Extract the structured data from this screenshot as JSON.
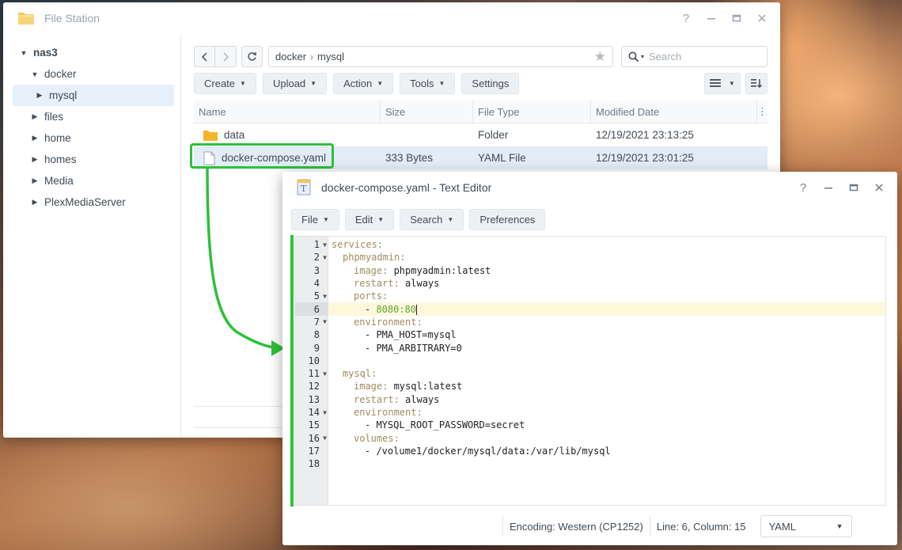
{
  "file_station": {
    "title": "File Station",
    "window_controls": {
      "help": "?"
    },
    "tree": [
      {
        "label": "nas3",
        "level": 0,
        "expanded": true
      },
      {
        "label": "docker",
        "level": 1,
        "expanded": true
      },
      {
        "label": "mysql",
        "level": 2,
        "expanded": false,
        "selected": true
      },
      {
        "label": "files",
        "level": 1,
        "expanded": false
      },
      {
        "label": "home",
        "level": 1,
        "expanded": false
      },
      {
        "label": "homes",
        "level": 1,
        "expanded": false
      },
      {
        "label": "Media",
        "level": 1,
        "expanded": false
      },
      {
        "label": "PlexMediaServer",
        "level": 1,
        "expanded": false
      }
    ],
    "path": [
      "docker",
      "mysql"
    ],
    "search_placeholder": "Search",
    "toolbar": {
      "create": "Create",
      "upload": "Upload",
      "action": "Action",
      "tools": "Tools",
      "settings": "Settings"
    },
    "columns": {
      "name": "Name",
      "size": "Size",
      "type": "File Type",
      "modified": "Modified Date"
    },
    "rows": [
      {
        "name": "data",
        "size": "",
        "type": "Folder",
        "modified": "12/19/2021 23:13:25",
        "kind": "folder"
      },
      {
        "name": "docker-compose.yaml",
        "size": "333 Bytes",
        "type": "YAML File",
        "modified": "12/19/2021 23:01:25",
        "kind": "file",
        "selected": true
      }
    ]
  },
  "text_editor": {
    "title": "docker-compose.yaml - Text Editor",
    "window_controls": {
      "help": "?"
    },
    "menu": {
      "file": "File",
      "edit": "Edit",
      "search": "Search",
      "preferences": "Preferences"
    },
    "lines": [
      {
        "n": "1",
        "fold": true,
        "indent": 0,
        "key": "services:",
        "val": ""
      },
      {
        "n": "2",
        "fold": true,
        "indent": 1,
        "key": "phpmyadmin:",
        "val": ""
      },
      {
        "n": "3",
        "fold": false,
        "indent": 2,
        "key": "image:",
        "val": " phpmyadmin:latest"
      },
      {
        "n": "4",
        "fold": false,
        "indent": 2,
        "key": "restart:",
        "val": " always"
      },
      {
        "n": "5",
        "fold": true,
        "indent": 2,
        "key": "ports:",
        "val": ""
      },
      {
        "n": "6",
        "fold": false,
        "indent": 3,
        "key": "",
        "val": "- ",
        "num": "8080:80",
        "active": true
      },
      {
        "n": "7",
        "fold": true,
        "indent": 2,
        "key": "environment:",
        "val": ""
      },
      {
        "n": "8",
        "fold": false,
        "indent": 3,
        "key": "",
        "val": "- PMA_HOST=mysql"
      },
      {
        "n": "9",
        "fold": false,
        "indent": 3,
        "key": "",
        "val": "- PMA_ARBITRARY=0"
      },
      {
        "n": "10",
        "fold": false,
        "indent": 0,
        "key": "",
        "val": ""
      },
      {
        "n": "11",
        "fold": true,
        "indent": 1,
        "key": "mysql:",
        "val": ""
      },
      {
        "n": "12",
        "fold": false,
        "indent": 2,
        "key": "image:",
        "val": " mysql:latest"
      },
      {
        "n": "13",
        "fold": false,
        "indent": 2,
        "key": "restart:",
        "val": " always"
      },
      {
        "n": "14",
        "fold": true,
        "indent": 2,
        "key": "environment:",
        "val": ""
      },
      {
        "n": "15",
        "fold": false,
        "indent": 3,
        "key": "",
        "val": "- MYSQL_ROOT_PASSWORD=secret"
      },
      {
        "n": "16",
        "fold": true,
        "indent": 2,
        "key": "volumes:",
        "val": ""
      },
      {
        "n": "17",
        "fold": false,
        "indent": 3,
        "key": "",
        "val": "- /volume1/docker/mysql/data:/var/lib/mysql"
      },
      {
        "n": "18",
        "fold": false,
        "indent": 0,
        "key": "",
        "val": ""
      }
    ],
    "status": {
      "encoding": "Encoding: Western (CP1252)",
      "position": "Line: 6, Column: 15",
      "mode": "YAML"
    }
  },
  "colors": {
    "highlight_green": "#2fc03a",
    "selection_blue": "#e2edf8",
    "folder_yellow": "#f3b52a"
  }
}
